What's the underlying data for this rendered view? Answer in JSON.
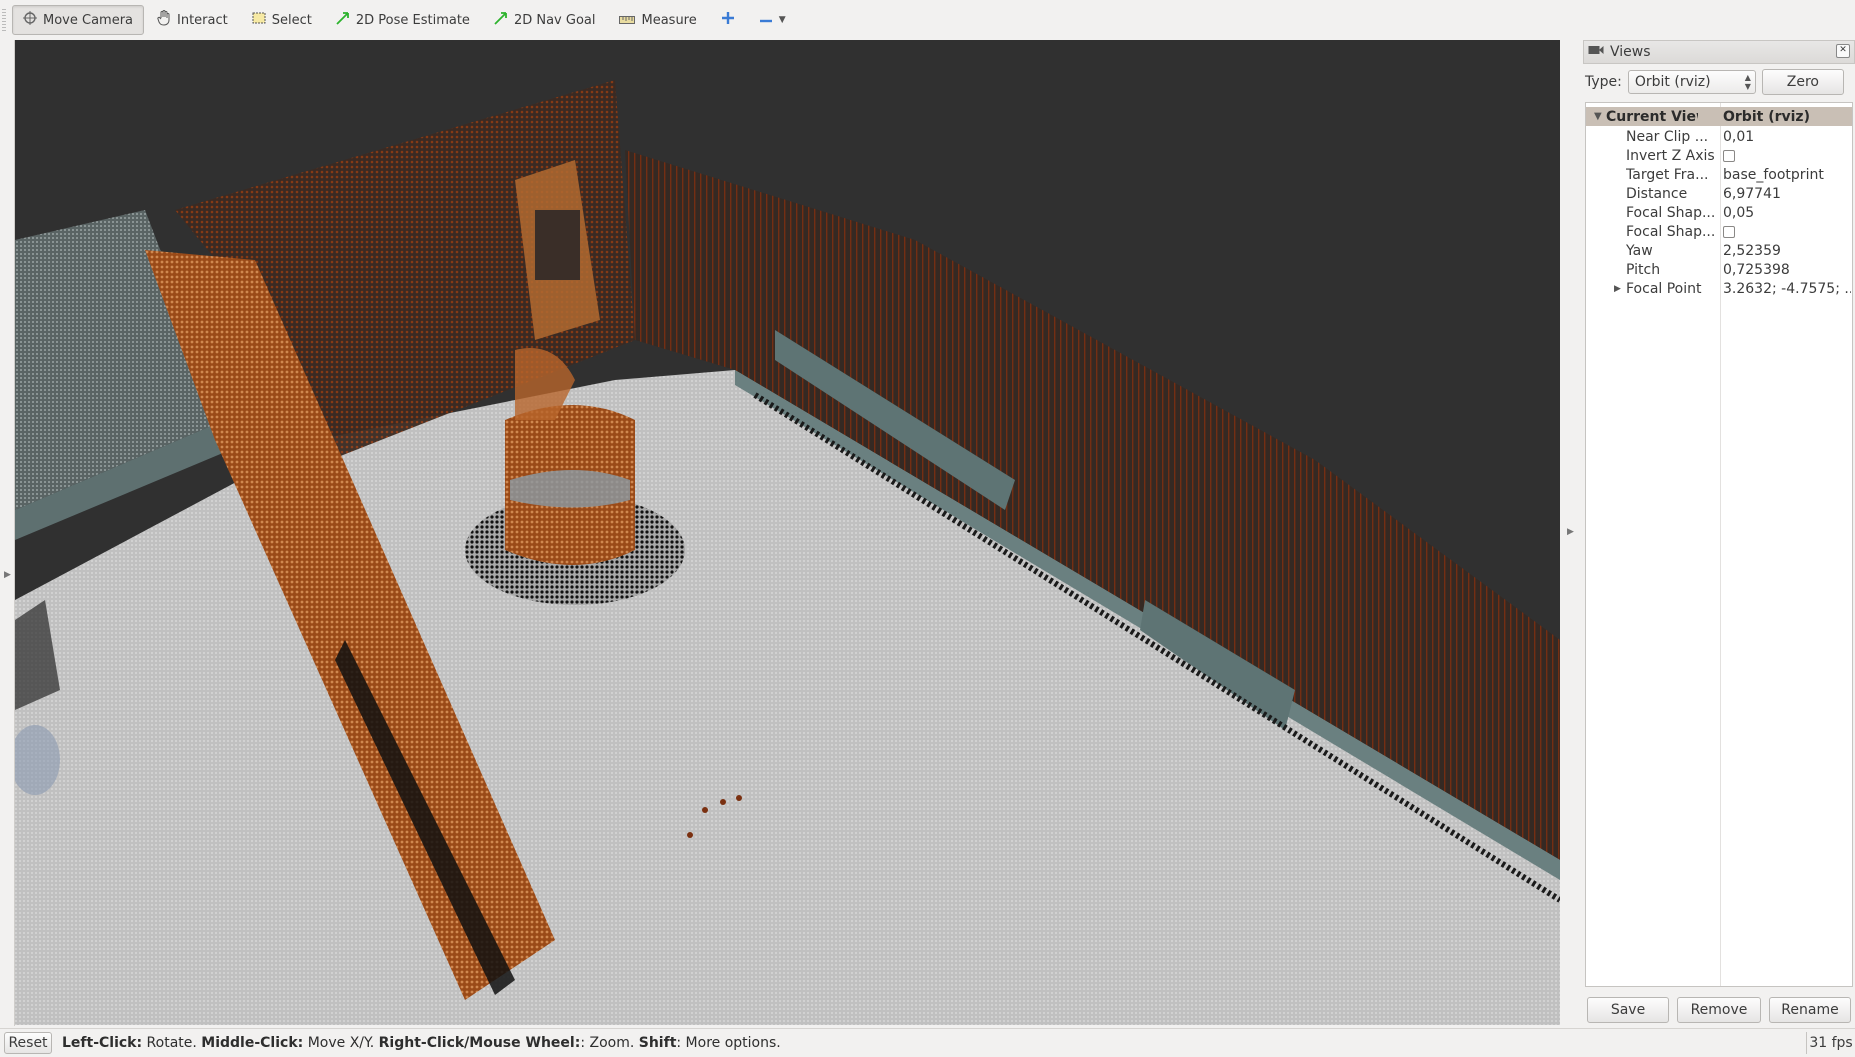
{
  "toolbar": {
    "tools": [
      {
        "label": "Move Camera",
        "icon": "move-camera-icon"
      },
      {
        "label": "Interact",
        "icon": "hand-icon"
      },
      {
        "label": "Select",
        "icon": "select-rect-icon"
      },
      {
        "label": "2D Pose Estimate",
        "icon": "pose-arrow-icon"
      },
      {
        "label": "2D Nav Goal",
        "icon": "goal-arrow-icon"
      },
      {
        "label": "Measure",
        "icon": "ruler-icon"
      }
    ],
    "active_tool": "Move Camera"
  },
  "views_panel": {
    "title": "Views",
    "type_label": "Type:",
    "type_value": "Orbit (rviz)",
    "zero_label": "Zero",
    "tree_header": {
      "name": "Current View",
      "value": "Orbit (rviz)"
    },
    "properties": [
      {
        "name": "Near Clip ...",
        "value": "0,01",
        "kind": "text"
      },
      {
        "name": "Invert Z Axis",
        "value": "",
        "kind": "checkbox"
      },
      {
        "name": "Target Fra...",
        "value": "base_footprint",
        "kind": "text"
      },
      {
        "name": "Distance",
        "value": "6,97741",
        "kind": "text"
      },
      {
        "name": "Focal Shap...",
        "value": "0,05",
        "kind": "text"
      },
      {
        "name": "Focal Shap...",
        "value": "",
        "kind": "checkbox"
      },
      {
        "name": "Yaw",
        "value": "2,52359",
        "kind": "text"
      },
      {
        "name": "Pitch",
        "value": "0,725398",
        "kind": "text"
      },
      {
        "name": "Focal Point",
        "value": "3.2632; -4.7575; ...",
        "kind": "expandable"
      }
    ],
    "buttons": {
      "save": "Save",
      "remove": "Remove",
      "rename": "Rename"
    }
  },
  "status_bar": {
    "reset_label": "Reset",
    "hint_parts": [
      {
        "bold": "Left-Click:",
        "text": " Rotate. "
      },
      {
        "bold": "Middle-Click:",
        "text": " Move X/Y. "
      },
      {
        "bold": "Right-Click/Mouse Wheel:",
        "text": ": Zoom. "
      },
      {
        "bold": "Shift",
        "text": ": More options."
      }
    ],
    "fps": "31 fps"
  },
  "colors": {
    "viewport_bg": "#303030",
    "floor": "#c2c2c2",
    "wall_points": "#8a3a14",
    "near_wall_points": "#b8652c",
    "tree_header": "#c9bfb5"
  }
}
